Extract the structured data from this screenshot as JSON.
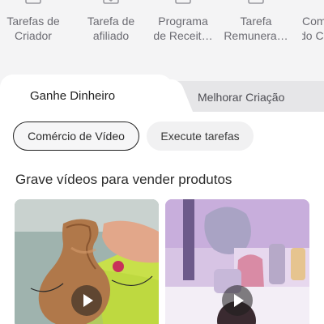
{
  "shortcuts": [
    {
      "line1": "Tarefas de",
      "line2": "Criador",
      "icon": "task-icon"
    },
    {
      "line1": "Tarefa de",
      "line2": "afiliado",
      "icon": "affiliate-icon"
    },
    {
      "line1": "Programa",
      "line2": "de Receit…",
      "icon": "revenue-program-icon"
    },
    {
      "line1": "Tarefa",
      "line2": "Remunera…",
      "icon": "paid-task-icon"
    },
    {
      "line1": "Com",
      "line2": "do Cr",
      "icon": "community-icon"
    }
  ],
  "tabs": {
    "active": "Ganhe Dinheiro",
    "inactive": "Melhorar Criação"
  },
  "chips": {
    "video_commerce": "Comércio de Vídeo",
    "tasks": "Execute tarefas"
  },
  "section": {
    "title": "Grave vídeos para vender produtos"
  },
  "colors": {
    "strip_bg": "#f4f4f5",
    "accent_dark": "#222222"
  }
}
